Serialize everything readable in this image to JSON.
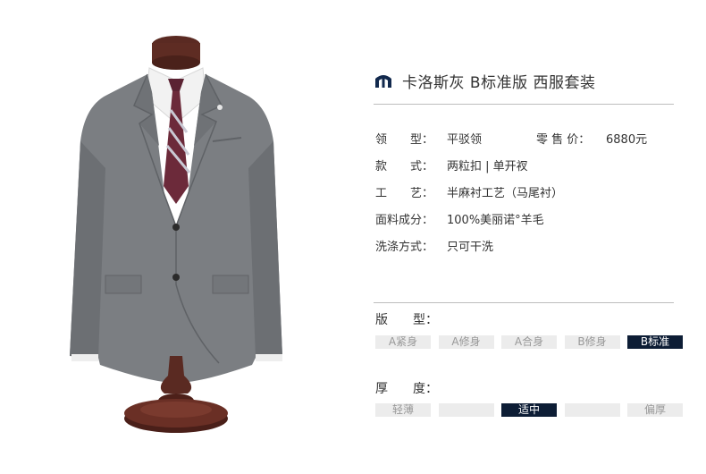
{
  "product": {
    "title": "卡洛斯灰 B标准版 西服套装",
    "logo_icon": "brand-crest-icon",
    "colors": {
      "accent": "#0d1d35",
      "option_bg": "#ececec",
      "rule": "#bdbdbd",
      "suit": "#7b7e82"
    }
  },
  "specs": {
    "lapel": {
      "label": "领　　型：",
      "value": "平驳领"
    },
    "price": {
      "label": "零 售 价：",
      "value": "6880元"
    },
    "style": {
      "label": "款　　式：",
      "value": "两粒扣 | 单开衩"
    },
    "craft": {
      "label": "工　　艺：",
      "value": "半麻衬工艺（马尾衬）"
    },
    "fabric": {
      "label": "面料成分：",
      "value": "100%美丽诺°羊毛"
    },
    "wash": {
      "label": "洗涤方式：",
      "value": "只可干洗"
    }
  },
  "fit": {
    "label": "版　　型：",
    "options": [
      "A紧身",
      "A修身",
      "A合身",
      "B修身",
      "B标准"
    ],
    "selected": "B标准"
  },
  "thickness": {
    "label": "厚　　度：",
    "options": [
      "轻薄",
      "",
      "适中",
      "",
      "偏厚"
    ],
    "selected": "适中"
  }
}
